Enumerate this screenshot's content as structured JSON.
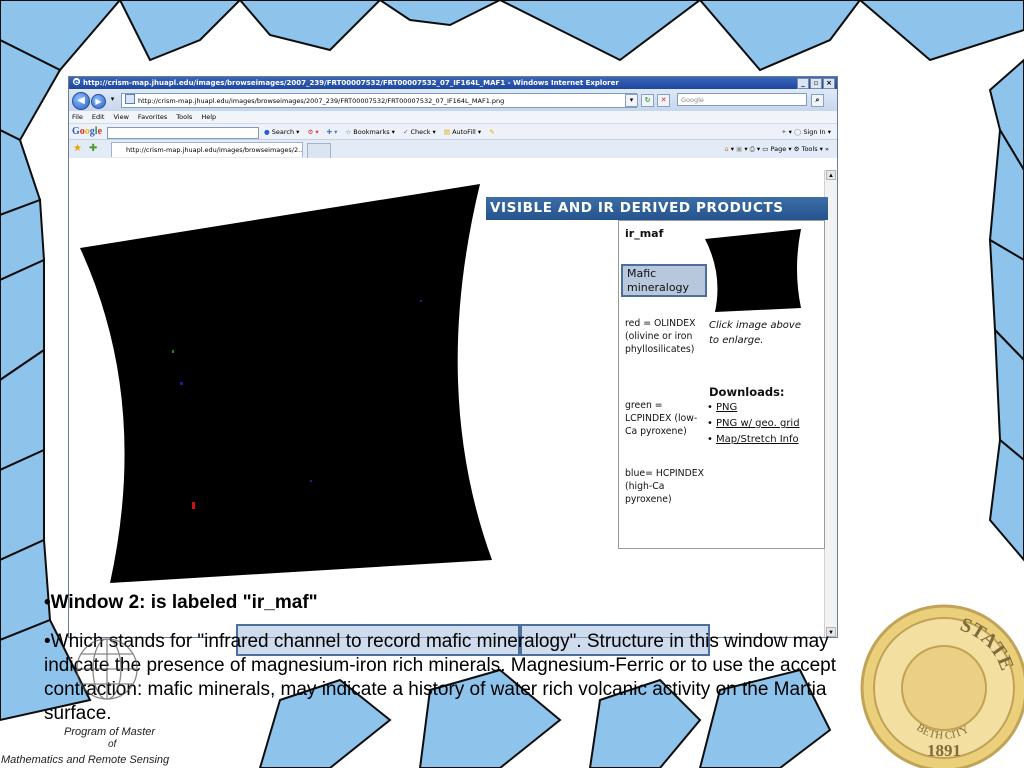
{
  "browser": {
    "window_title": "http://crism-map.jhuapl.edu/images/browseimages/2007_239/FRT00007532/FRT00007532_07_IF164L_MAF1 - Windows Internet Explorer",
    "address": "http://crism-map.jhuapl.edu/images/browseimages/2007_239/FRT00007532/FRT00007532_07_IF164L_MAF1.png",
    "search_placeholder": "Google",
    "menu": [
      "File",
      "Edit",
      "View",
      "Favorites",
      "Tools",
      "Help"
    ],
    "google_toolbar": {
      "logo": "Google",
      "items": [
        "Search",
        "Bookmarks",
        "Check",
        "AutoFill"
      ],
      "sign_in": "Sign In"
    },
    "tab_title": "http://crism-map.jhuapl.edu/images/browseimages/2...",
    "tab_tools": {
      "page": "Page",
      "tools": "Tools"
    }
  },
  "panel": {
    "header": "VISIBLE AND IR DERIVED PRODUCTS",
    "title": "ir_maf",
    "product_label": "Mafic mineralogy",
    "red_legend": "red = OLINDEX (olivine or iron phyllosilicates)",
    "green_legend": "green = LCPINDEX (low-Ca pyroxene)",
    "blue_legend": "blue= HCPINDEX (high-Ca pyroxene)",
    "click_hint": "Click image above to enlarge.",
    "downloads_title": "Downloads:",
    "downloads": [
      "PNG",
      "PNG w/ geo. grid",
      "Map/Stretch Info"
    ]
  },
  "caption": {
    "heading": "•Window 2: is labeled \"ir_maf\"",
    "line1": "•Which stands for \"infrared channel to record mafic mineralogy\". Structure in this window may",
    "line2": "indicate the presence of magnesium-iron rich minerals. Magnesium-Ferric or to use the accept",
    "line3": "contraction: mafic minerals, may indicate a history of water rich volcanic activity on the Martia",
    "line4": "surface."
  },
  "footer": {
    "line1": "Program of Master",
    "line2": "of",
    "line3": "Mathematics and Remote Sensing"
  },
  "seal": {
    "text_top": "STATE",
    "text_bottom": "BETH CITY",
    "year": "1891"
  },
  "colors": {
    "background_shapes": "#8ec3ec",
    "shape_outline": "#0d0d0d",
    "panel_header": "#2b5b96",
    "highlight_border": "#4d6f9c",
    "seal_gold": "#c9a53a"
  }
}
